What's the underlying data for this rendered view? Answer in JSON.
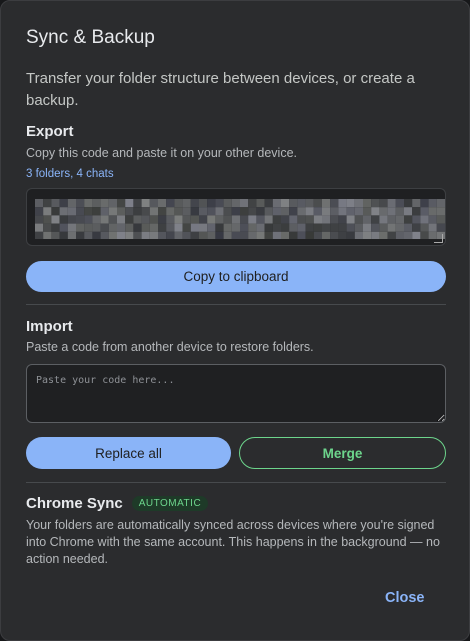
{
  "dialog": {
    "title": "Sync & Backup",
    "subtitle": "Transfer your folder structure between devices, or create a backup."
  },
  "export": {
    "heading": "Export",
    "description": "Copy this code and paste it on your other device.",
    "count": "3 folders, 4 chats",
    "code_obscured": true,
    "copy_label": "Copy to clipboard"
  },
  "import": {
    "heading": "Import",
    "description": "Paste a code from another device to restore folders.",
    "placeholder": "Paste your code here...",
    "value": "",
    "replace_label": "Replace all",
    "merge_label": "Merge"
  },
  "chrome_sync": {
    "heading": "Chrome Sync",
    "badge": "AUTOMATIC",
    "text": "Your folders are automatically synced across devices where you're signed into Chrome with the same account. This happens in the background — no action needed."
  },
  "footer": {
    "close_label": "Close"
  },
  "colors": {
    "accent": "#8ab4f8",
    "success": "#6dd58c",
    "surface": "#2b2c2e"
  }
}
